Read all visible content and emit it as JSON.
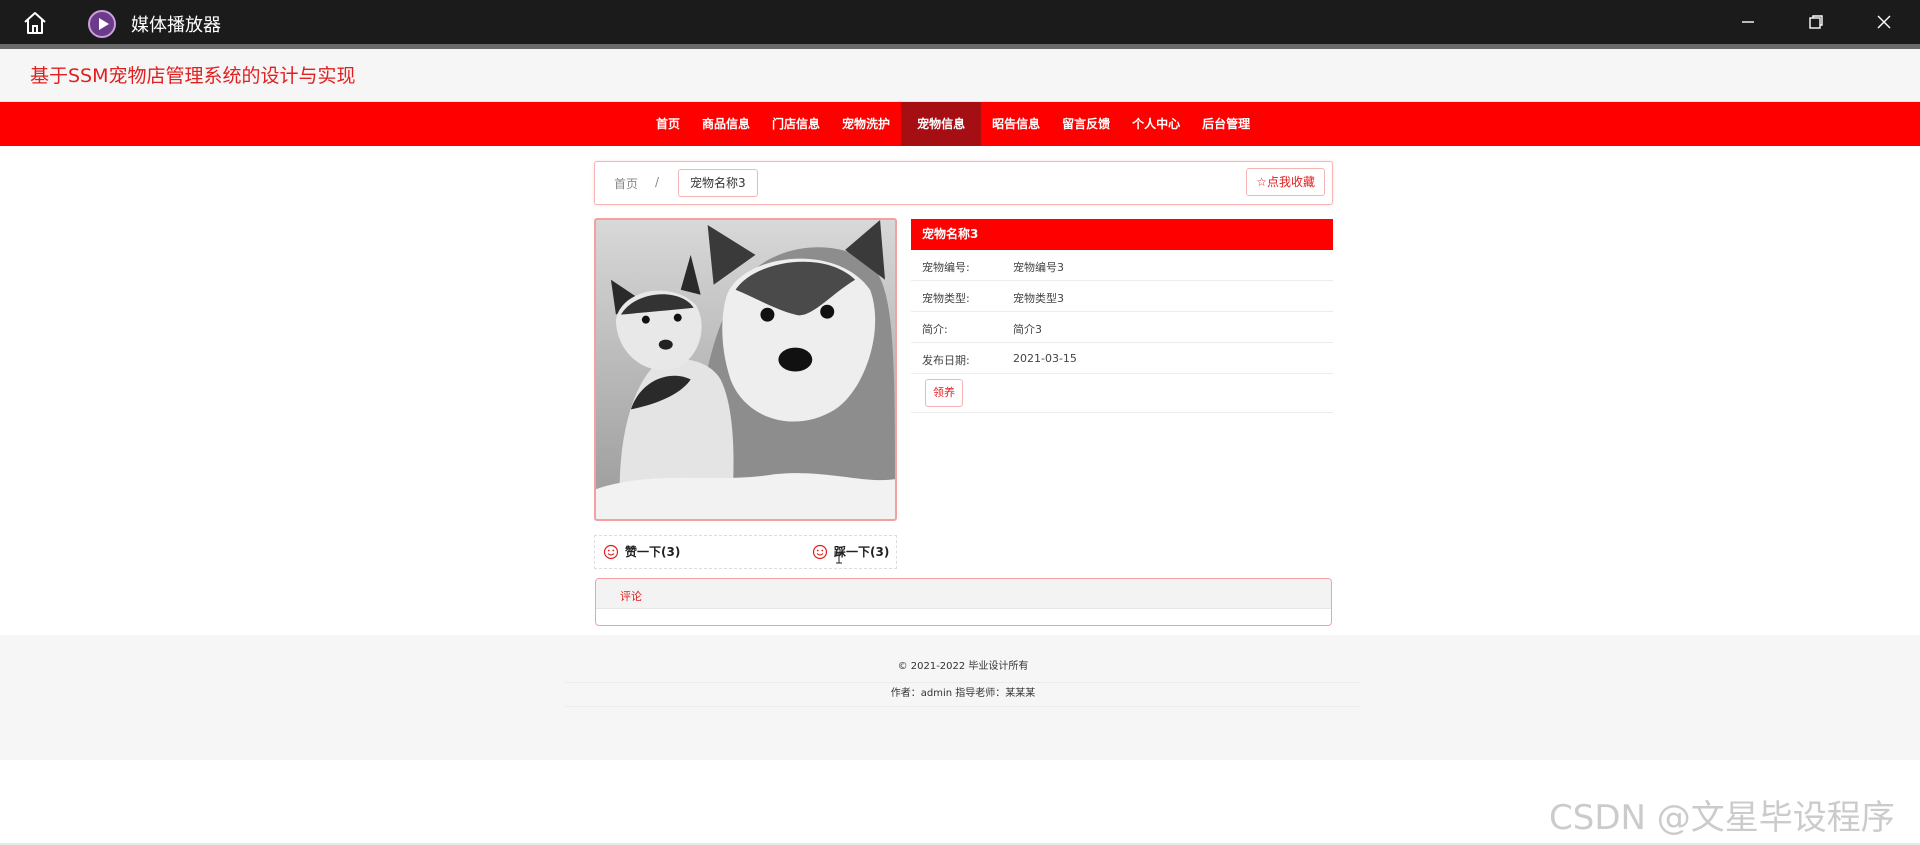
{
  "window": {
    "title": "媒体播放器",
    "controls": [
      "minimize-icon",
      "restore-icon",
      "close-icon"
    ]
  },
  "site": {
    "brand": "基于SSM宠物店管理系统的设计与实现"
  },
  "nav": {
    "items": [
      "首页",
      "商品信息",
      "门店信息",
      "宠物洗护",
      "宠物信息",
      "昭告信息",
      "留言反馈",
      "个人中心",
      "后台管理"
    ],
    "active_index": 4
  },
  "breadcrumb": {
    "home": "首页",
    "separator": "/",
    "current": "宠物名称3",
    "favorite_label": "☆点我收藏"
  },
  "reactions": {
    "like_label": "赞一下(3)",
    "dislike_label": "踩一下(3)"
  },
  "info": {
    "title": "宠物名称3",
    "rows": [
      {
        "key": "宠物编号:",
        "value": "宠物编号3"
      },
      {
        "key": "宠物类型:",
        "value": "宠物类型3"
      },
      {
        "key": "简介:",
        "value": "简介3"
      },
      {
        "key": "发布日期:",
        "value": "2021-03-15"
      }
    ],
    "adopt_label": "领养"
  },
  "comments": {
    "title": "评论"
  },
  "footer": {
    "copyright": "© 2021-2022 毕业设计所有",
    "credits": "作者：admin 指导老师：某某某"
  },
  "watermark": "CSDN @文星毕设程序",
  "colors": {
    "accent": "#ff0000",
    "nav_active": "#a50f14",
    "brand_text": "#e02020",
    "titlebar": "#1b1b1b"
  }
}
